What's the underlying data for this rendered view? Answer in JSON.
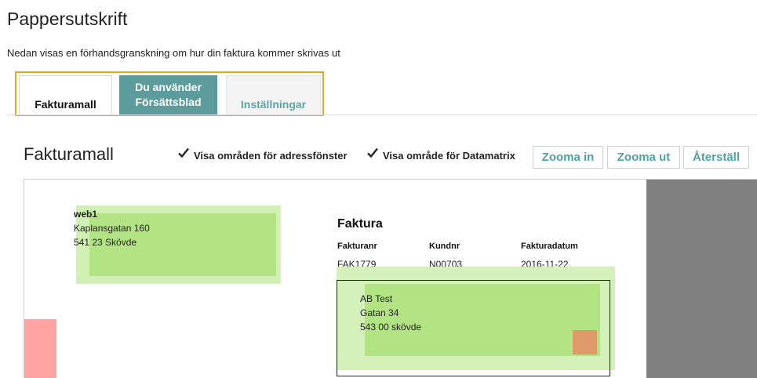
{
  "header": {
    "title": "Pappersutskrift",
    "subtitle": "Nedan visas en förhandsgranskning om hur din faktura kommer skrivas ut"
  },
  "tabs": [
    {
      "label": "Fakturamall",
      "active": true
    },
    {
      "label_line1": "Du använder",
      "label_line2": "Försättsblad",
      "highlighted": true
    },
    {
      "label": "Inställningar"
    }
  ],
  "toolbar": {
    "section_title": "Fakturamall",
    "checkbox_address": {
      "label": "Visa områden för adressfönster",
      "checked": true
    },
    "checkbox_datamatrix": {
      "label": "Visa område för Datamatrix",
      "checked": true
    },
    "zoom_in": "Zooma in",
    "zoom_out": "Zooma ut",
    "reset": "Återställ"
  },
  "preview": {
    "sender": {
      "name": "web1",
      "street": "Kaplansgatan 160",
      "city": "541 23 Skövde"
    },
    "invoice": {
      "title": "Faktura",
      "headers": [
        "Fakturanr",
        "Kundnr",
        "Fakturadatum"
      ],
      "values": [
        "FAK1779",
        "N00703",
        "2016-11-22"
      ]
    },
    "recipient": {
      "name": "AB Test",
      "street": "Gatan 34",
      "city": "543 00 skövde"
    }
  },
  "colors": {
    "accent": "#e2a72b",
    "tab_active_bg": "#5d9c9c",
    "link_teal": "#4fa3a3",
    "address_zone_outer": "#d0f0b4",
    "address_zone_inner": "#b3e484",
    "datamatrix_zone": "#df9a6a",
    "margin_zone": "#ffa3a3",
    "outside_page": "#808080"
  }
}
